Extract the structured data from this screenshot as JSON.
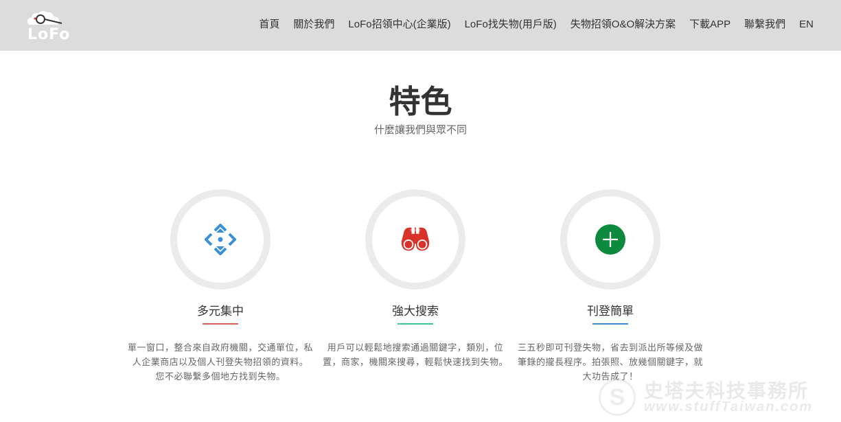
{
  "header": {
    "logo_text": "LoFo",
    "nav": [
      {
        "label": "首頁"
      },
      {
        "label": "關於我們"
      },
      {
        "label": "LoFo招領中心(企業版)"
      },
      {
        "label": "LoFo找失物(用戶版)"
      },
      {
        "label": "失物招領O&O解決方案"
      },
      {
        "label": "下載APP"
      },
      {
        "label": "聯繫我們"
      },
      {
        "label": "EN"
      }
    ]
  },
  "section": {
    "title": "特色",
    "subtitle": "什麼讓我們與眾不同"
  },
  "features": [
    {
      "icon": "arrows-move-icon",
      "title": "多元集中",
      "description": "單一窗口，整合來自政府機關，交通單位，私人企業商店以及個人刊登失物招領的資料。 您不必聯繫多個地方找到失物。",
      "accent": "#e05a58",
      "icon_color": "#3a8fd6"
    },
    {
      "icon": "binoculars-icon",
      "title": "強大搜索",
      "description": "用戶可以輕鬆地搜索通過關鍵字，類別，位置，商家，機關來搜尋，輕鬆快速找到失物。",
      "accent": "#3cc29a",
      "icon_color": "#d93228"
    },
    {
      "icon": "plus-circle-icon",
      "title": "刊登簡單",
      "description": "三五秒即可刊登失物，省去到派出所等候及做筆錄的攏長程序。拍張照、放幾個關鍵字，就大功告成了！",
      "accent": "#3a8fd6",
      "icon_color": "#0e8a3e"
    }
  ],
  "watermark": {
    "title": "史塔夫科技事務所",
    "url": "www.stuffTaiwan.com",
    "glyph": "S"
  },
  "colors": {
    "header_bg": "#dcdcdc",
    "ring": "#ebebeb"
  }
}
